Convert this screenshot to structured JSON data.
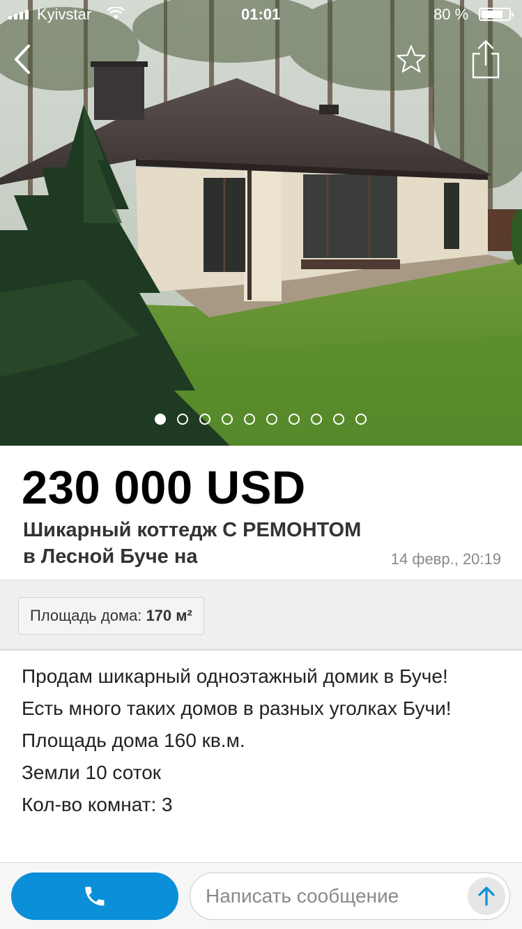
{
  "status_bar": {
    "carrier": "Kyivstar",
    "time": "01:01",
    "battery_percent_label": "80 %",
    "battery_level": 0.8
  },
  "nav": {
    "back_icon": "chevron-left-icon",
    "favorite_icon": "star-outline-icon",
    "share_icon": "share-icon"
  },
  "gallery": {
    "photo_count": 10,
    "active_index": 0
  },
  "listing": {
    "price": "230 000 USD",
    "title": "Шикарный коттедж С РЕМОНТОМ в Лесной Буче на",
    "date": "14 февр., 20:19"
  },
  "params": {
    "area_label": "Площадь дома:",
    "area_value": "170 м²"
  },
  "description": {
    "lines": [
      "Продам шикарный одноэтажный домик в Буче!",
      "Есть много таких домов в разных уголках Бучи!",
      "Площадь дома 160 кв.м.",
      "Земли 10 соток",
      "Кол-во комнат: 3"
    ]
  },
  "bottom_bar": {
    "call_icon": "phone-icon",
    "message_placeholder": "Написать сообщение",
    "send_icon": "arrow-up-icon"
  },
  "colors": {
    "accent": "#0b8fd8",
    "send_arrow": "#0b8fd8"
  }
}
